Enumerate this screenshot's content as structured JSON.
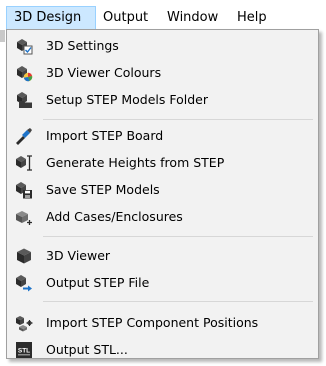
{
  "menubar": {
    "items": [
      {
        "label": "3D Design"
      },
      {
        "label": "Output"
      },
      {
        "label": "Window"
      },
      {
        "label": "Help"
      }
    ]
  },
  "dropdown": {
    "items": [
      {
        "label": "3D Settings",
        "icon": "cube-settings-icon"
      },
      {
        "label": "3D Viewer Colours",
        "icon": "cube-colours-icon"
      },
      {
        "label": "Setup STEP Models Folder",
        "icon": "cube-folder-icon"
      },
      {
        "label": "Import STEP Board",
        "icon": "import-board-icon"
      },
      {
        "label": "Generate Heights from STEP",
        "icon": "cube-height-icon"
      },
      {
        "label": "Save STEP Models",
        "icon": "cube-save-icon"
      },
      {
        "label": "Add Cases/Enclosures",
        "icon": "cube-add-icon"
      },
      {
        "label": "3D Viewer",
        "icon": "cube-viewer-icon"
      },
      {
        "label": "Output STEP File",
        "icon": "cube-output-icon"
      },
      {
        "label": "Import STEP Component Positions",
        "icon": "cube-positions-icon"
      },
      {
        "label": "Output STL...",
        "icon": "stl-icon"
      }
    ]
  },
  "colors": {
    "active_menu_bg": "#cce8ff",
    "dropdown_bg": "#f2f2f2",
    "icon_dark": "#2b2b2b",
    "icon_blue": "#1e73c8"
  }
}
